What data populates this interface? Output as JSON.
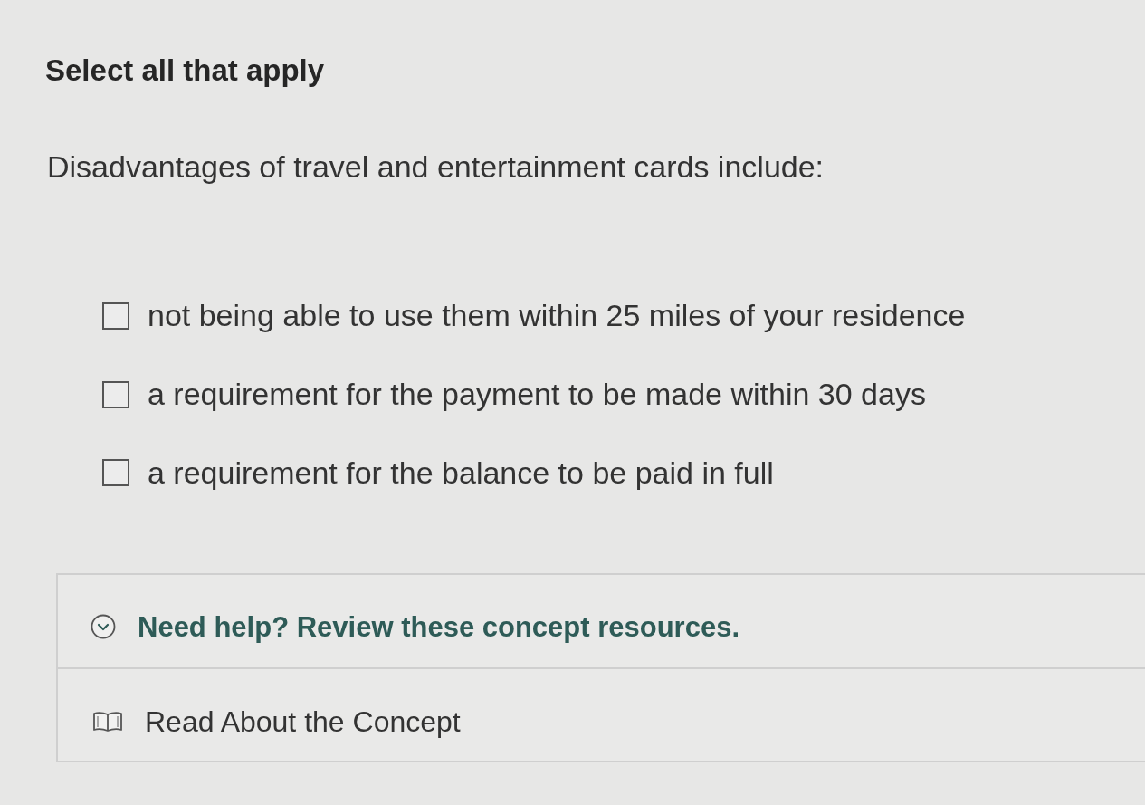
{
  "prompt": {
    "title": "Select all that apply",
    "question": "Disadvantages of travel and entertainment cards include:"
  },
  "options": [
    {
      "label": "not being able to use them within 25 miles of your residence",
      "checked": false
    },
    {
      "label": "a requirement for the payment to be made within 30 days",
      "checked": false
    },
    {
      "label": "a requirement for the balance to be paid in full",
      "checked": false
    }
  ],
  "help": {
    "title": "Need help? Review these concept resources.",
    "expanded": true,
    "resources": [
      {
        "label": "Read About the Concept"
      }
    ]
  }
}
